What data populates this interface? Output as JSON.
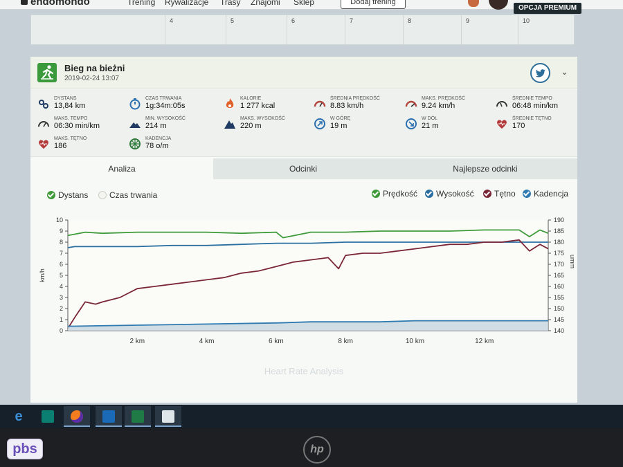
{
  "nav": {
    "logo": "endomondo",
    "items": [
      "Trening",
      "Rywalizacje",
      "Trasy",
      "Znajomi",
      "Sklep"
    ],
    "add_training": "Dodaj trening",
    "premium": "OPCJA PREMIUM"
  },
  "calendar": {
    "days": [
      "4",
      "5",
      "6",
      "7",
      "8",
      "9",
      "10"
    ]
  },
  "workout": {
    "title": "Bieg na bieżni",
    "date": "2019-02-24 13:07"
  },
  "stats": [
    {
      "label": "DYSTANS",
      "value": "13,84 km",
      "icon": "route-icon"
    },
    {
      "label": "CZAS TRWANIA",
      "value": "1g:34m:05s",
      "icon": "stopwatch-icon"
    },
    {
      "label": "KALORIE",
      "value": "1 277 kcal",
      "icon": "flame-icon"
    },
    {
      "label": "ŚREDNIA PRĘDKOŚĆ",
      "value": "8.83 km/h",
      "icon": "speedometer-icon"
    },
    {
      "label": "MAKS. PRĘDKOŚĆ",
      "value": "9.24 km/h",
      "icon": "speedometer-max-icon"
    },
    {
      "label": "ŚREDNIE TEMPO",
      "value": "06:48 min/km",
      "icon": "pace-icon"
    },
    {
      "label": "MAKS. TEMPO",
      "value": "06:30 min/km",
      "icon": "pace-max-icon"
    },
    {
      "label": "MIN. WYSOKOŚĆ",
      "value": "214 m",
      "icon": "mountain-min-icon"
    },
    {
      "label": "MAKS. WYSOKOŚĆ",
      "value": "220 m",
      "icon": "mountain-max-icon"
    },
    {
      "label": "W GÓRĘ",
      "value": "19 m",
      "icon": "ascent-icon"
    },
    {
      "label": "W DÓŁ",
      "value": "21 m",
      "icon": "descent-icon"
    },
    {
      "label": "ŚREDNIE TĘTNO",
      "value": "170",
      "icon": "heart-icon"
    },
    {
      "label": "MAKS. TĘTNO",
      "value": "186",
      "icon": "heart-max-icon"
    },
    {
      "label": "KADENCJA",
      "value": "78 o/m",
      "icon": "cadence-icon"
    }
  ],
  "tabs": [
    "Analiza",
    "Odcinki",
    "Najlepsze odcinki"
  ],
  "axis_options": [
    "Dystans",
    "Czas trwania"
  ],
  "series_toggles": [
    {
      "label": "Prędkość",
      "color": "#3f9a3a"
    },
    {
      "label": "Wysokość",
      "color": "#2a6fa0"
    },
    {
      "label": "Tętno",
      "color": "#7a2637"
    },
    {
      "label": "Kadencja",
      "color": "#2f7ab0"
    }
  ],
  "chart_caption": "Heart Rate Analysis",
  "chart_data": {
    "type": "line",
    "xlabel": "",
    "ylabel": "km/h",
    "y2label": "umm",
    "x_ticks": [
      "2 km",
      "4 km",
      "6 km",
      "8 km",
      "10 km",
      "12 km"
    ],
    "y_ticks": [
      "0",
      "1",
      "2",
      "3",
      "4",
      "5",
      "6",
      "7",
      "8",
      "9",
      "10"
    ],
    "y2_ticks": [
      "140",
      "145",
      "150",
      "155",
      "160",
      "165",
      "170",
      "175",
      "180",
      "185",
      "190"
    ],
    "xlim": [
      0,
      13.84
    ],
    "ylim": [
      0,
      10
    ],
    "y2lim": [
      140,
      190
    ],
    "series": [
      {
        "name": "Prędkość",
        "color": "#3f9a3a",
        "axis": "left",
        "x": [
          0,
          0.5,
          1,
          2,
          3,
          4,
          5,
          6,
          6.2,
          7,
          8,
          9,
          10,
          11,
          12,
          13,
          13.3,
          13.6,
          13.84
        ],
        "y": [
          8.6,
          8.9,
          8.8,
          8.9,
          8.9,
          8.9,
          8.8,
          8.9,
          8.4,
          8.9,
          8.9,
          9.0,
          9.0,
          9.0,
          9.1,
          9.1,
          8.5,
          9.1,
          8.8
        ]
      },
      {
        "name": "Wysokość",
        "color": "#2a6fa0",
        "axis": "left",
        "x": [
          0,
          0.2,
          1,
          2,
          3,
          4,
          5,
          6,
          7,
          8,
          9,
          10,
          11,
          12,
          13,
          13.84
        ],
        "y": [
          7.5,
          7.6,
          7.6,
          7.6,
          7.7,
          7.7,
          7.8,
          7.9,
          7.9,
          8.0,
          8.0,
          8.0,
          8.0,
          8.0,
          8.0,
          8.0
        ]
      },
      {
        "name": "Tętno",
        "color": "#7a2637",
        "axis": "right",
        "x": [
          0,
          0.2,
          0.5,
          0.8,
          1,
          1.5,
          2,
          2.5,
          3,
          3.5,
          4,
          4.5,
          5,
          5.5,
          6,
          6.5,
          7,
          7.5,
          7.8,
          8,
          8.5,
          9,
          9.5,
          10,
          10.5,
          11,
          11.5,
          12,
          12.5,
          13,
          13.3,
          13.6,
          13.84
        ],
        "y": [
          141,
          146,
          153,
          152,
          153,
          155,
          159,
          160,
          161,
          162,
          163,
          164,
          166,
          167,
          169,
          171,
          172,
          173,
          168,
          174,
          175,
          175,
          176,
          177,
          178,
          179,
          179,
          180,
          180,
          181,
          176,
          179,
          177
        ]
      },
      {
        "name": "Kadencja",
        "color": "#2f7ab0",
        "axis": "left",
        "x": [
          0,
          2,
          4,
          6,
          7,
          8,
          9,
          10,
          11,
          12,
          13,
          13.84
        ],
        "y": [
          0.4,
          0.5,
          0.6,
          0.7,
          0.8,
          0.8,
          0.8,
          0.9,
          0.9,
          0.9,
          0.9,
          0.9
        ]
      }
    ]
  }
}
